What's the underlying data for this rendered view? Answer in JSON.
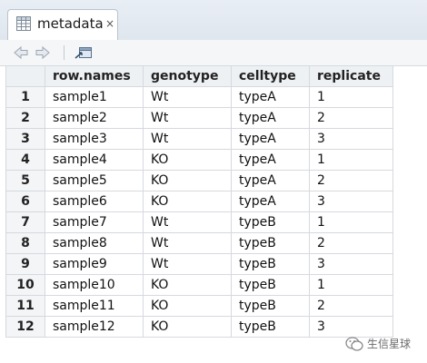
{
  "tab": {
    "title": "metadata",
    "icon": "table-icon",
    "close_label": "×"
  },
  "toolbar": {
    "back_icon": "back-arrow-icon",
    "forward_icon": "forward-arrow-icon",
    "popout_icon": "popout-window-icon"
  },
  "table": {
    "columns": [
      "row.names",
      "genotype",
      "celltype",
      "replicate"
    ],
    "rows": [
      {
        "num": "1",
        "cells": [
          "sample1",
          "Wt",
          "typeA",
          "1"
        ]
      },
      {
        "num": "2",
        "cells": [
          "sample2",
          "Wt",
          "typeA",
          "2"
        ]
      },
      {
        "num": "3",
        "cells": [
          "sample3",
          "Wt",
          "typeA",
          "3"
        ]
      },
      {
        "num": "4",
        "cells": [
          "sample4",
          "KO",
          "typeA",
          "1"
        ]
      },
      {
        "num": "5",
        "cells": [
          "sample5",
          "KO",
          "typeA",
          "2"
        ]
      },
      {
        "num": "6",
        "cells": [
          "sample6",
          "KO",
          "typeA",
          "3"
        ]
      },
      {
        "num": "7",
        "cells": [
          "sample7",
          "Wt",
          "typeB",
          "1"
        ]
      },
      {
        "num": "8",
        "cells": [
          "sample8",
          "Wt",
          "typeB",
          "2"
        ]
      },
      {
        "num": "9",
        "cells": [
          "sample9",
          "Wt",
          "typeB",
          "3"
        ]
      },
      {
        "num": "10",
        "cells": [
          "sample10",
          "KO",
          "typeB",
          "1"
        ]
      },
      {
        "num": "11",
        "cells": [
          "sample11",
          "KO",
          "typeB",
          "2"
        ]
      },
      {
        "num": "12",
        "cells": [
          "sample12",
          "KO",
          "typeB",
          "3"
        ]
      }
    ]
  },
  "watermark": {
    "text": "生信星球",
    "icon": "wechat-logo-icon"
  }
}
